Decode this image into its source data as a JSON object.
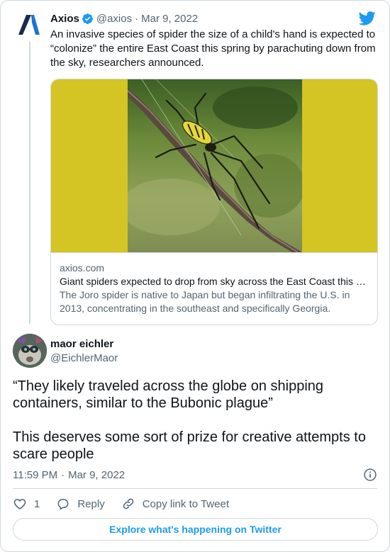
{
  "parent_tweet": {
    "name": "Axios",
    "handle": "@axios",
    "separator": "·",
    "date": "Mar 9, 2022",
    "text": "An invasive species of spider the size of a child's hand is expected to “colonize” the entire East Coast this spring by parachuting down from the sky, researchers announced.",
    "link_card": {
      "domain": "axios.com",
      "title": "Giant spiders expected to drop from sky across the East Coast this spring",
      "description": "The Joro spider is native to Japan but began infiltrating the U.S. in 2013, concentrating in the southeast and specifically Georgia."
    }
  },
  "main_tweet": {
    "name": "maor eichler",
    "handle": "@EichlerMaor",
    "text_paragraphs": [
      "“They likely traveled across the globe on shipping containers, similar to the Bubonic plague”",
      "This deserves some sort of prize for creative attempts to scare people"
    ],
    "time": "11:59 PM",
    "separator": "·",
    "date": "Mar 9, 2022"
  },
  "actions": {
    "like_count": "1",
    "reply_label": "Reply",
    "copy_link_label": "Copy link to Tweet"
  },
  "explore_label": "Explore what's happening on Twitter",
  "icons": {
    "verified": "verified-badge-icon",
    "brand": "twitter-bird-icon",
    "info": "info-icon",
    "like": "heart-icon",
    "reply": "speech-bubble-icon",
    "copy_link": "link-icon"
  },
  "colors": {
    "accent": "#1d9bf0",
    "text_primary": "#0f1419",
    "text_secondary": "#536471",
    "border": "#cfd9de",
    "image_background": "#d4c424"
  }
}
